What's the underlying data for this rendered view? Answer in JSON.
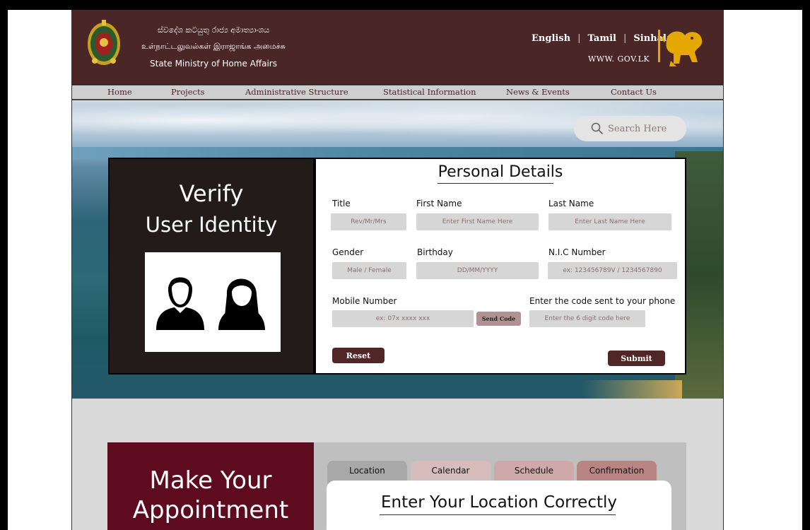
{
  "header": {
    "ministry_sinhala": "ස්වදේශ කටයුතු රාජ්‍ය අමාත්‍යාංශය",
    "ministry_tamil": "உள்நாட்டலுவல்கள் இராஜாங்க அமைச்சு",
    "ministry_english": "State Ministry of Home Affairs",
    "languages": [
      "English",
      "Tamil",
      "Sinhala"
    ],
    "website": "WWW. GOV.LK"
  },
  "nav": {
    "items": [
      "Home",
      "Projects",
      "Administrative Structure",
      "Statistical Information",
      "News & Events",
      "Contact Us"
    ]
  },
  "search": {
    "placeholder": "Search Here"
  },
  "verify": {
    "title_line1": "Verify",
    "title_line2": "User Identity",
    "form_title": "Personal Details",
    "fields": {
      "title": {
        "label": "Title",
        "placeholder": "Rev/Mr/Mrs"
      },
      "first_name": {
        "label": "First Name",
        "placeholder": "Enter First Name Here"
      },
      "last_name": {
        "label": "Last Name",
        "placeholder": "Enter Last Name Here"
      },
      "gender": {
        "label": "Gender",
        "placeholder": "Male / Female"
      },
      "birthday": {
        "label": "Birthday",
        "placeholder": "DD/MM/YYYY"
      },
      "nic": {
        "label": "N.I.C Number",
        "placeholder": "ex: 123456789V / 1234567890"
      },
      "mobile": {
        "label": "Mobile Number",
        "placeholder": "ex: 07x xxxx xxx"
      },
      "code": {
        "label": "Enter the code sent to your phone",
        "placeholder": "Enter the 6 digit code here"
      }
    },
    "send_code_label": "Send Code",
    "reset_label": "Reset",
    "submit_label": "Submit"
  },
  "appointment": {
    "title_line1": "Make Your",
    "title_line2": "Appointment",
    "tabs": [
      "Location",
      "Calendar",
      "Schedule",
      "Confirmation"
    ],
    "location_title": "Enter Your Location Correctly"
  },
  "colors": {
    "header_bg": "#4b2626",
    "accent_maroon": "#5e0a1f",
    "button_dark": "#502626"
  }
}
